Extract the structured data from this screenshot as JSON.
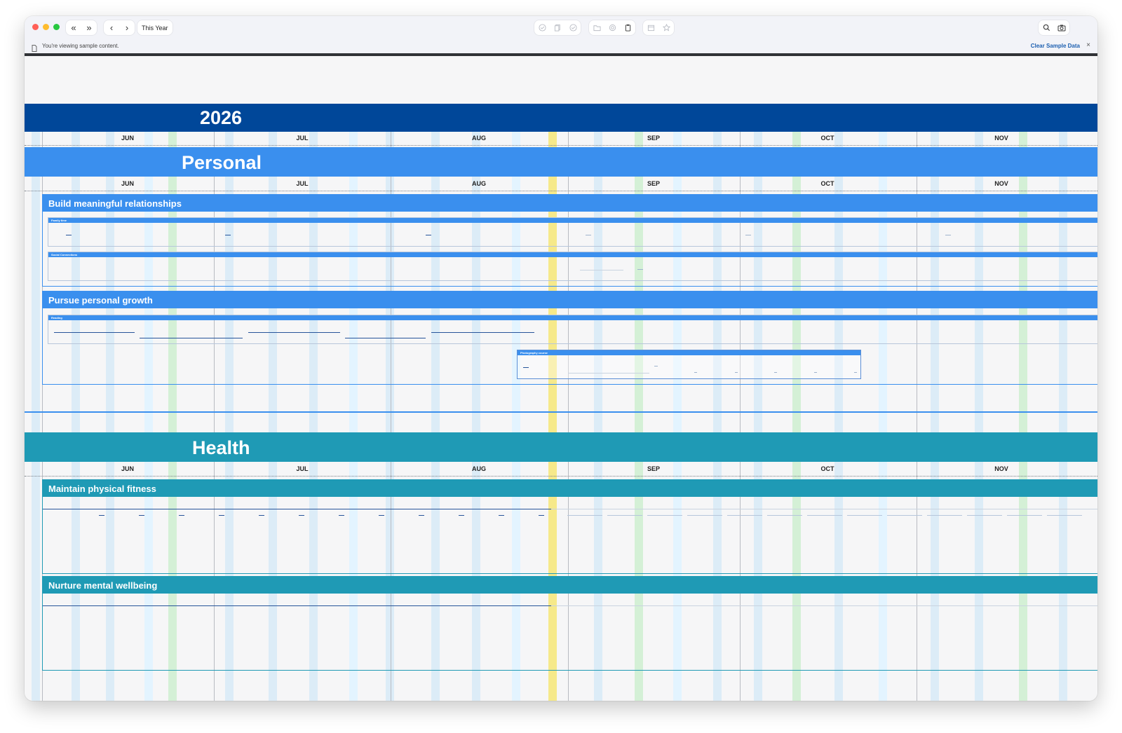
{
  "toolbar": {
    "nav_back_double": "«",
    "nav_forward_double": "»",
    "nav_prev": "‹",
    "nav_next": "›",
    "period_label": "This Year",
    "icons": [
      "circle-check-icon",
      "documents-icon",
      "circle-check-icon",
      "folder-icon",
      "target-icon",
      "clipboard-icon",
      "calendar-icon",
      "star-icon",
      "search-icon",
      "camera-icon"
    ]
  },
  "infobar": {
    "message": "You're viewing sample content.",
    "clear_label": "Clear Sample Data",
    "close": "×"
  },
  "timeline": {
    "year": "2026",
    "months": [
      "JUN",
      "JUL",
      "AUG",
      "SEP",
      "OCT",
      "NOV"
    ],
    "today_marker": "mid-AUG",
    "colors": {
      "year_band": "#004799",
      "personal": "#3a8fee",
      "health": "#1f9ab5",
      "today_highlight": "#f6e98a"
    }
  },
  "areas": [
    {
      "title": "Personal",
      "goals": [
        {
          "title": "Build meaningful relationships",
          "subgoals": [
            "Family time",
            "Social Connections"
          ]
        },
        {
          "title": "Pursue personal growth",
          "subgoals": [
            "Reading"
          ],
          "projects": [
            "Photography course"
          ]
        }
      ]
    },
    {
      "title": "Health",
      "goals": [
        {
          "title": "Maintain physical fitness"
        },
        {
          "title": "Nurture mental wellbeing"
        }
      ]
    }
  ]
}
